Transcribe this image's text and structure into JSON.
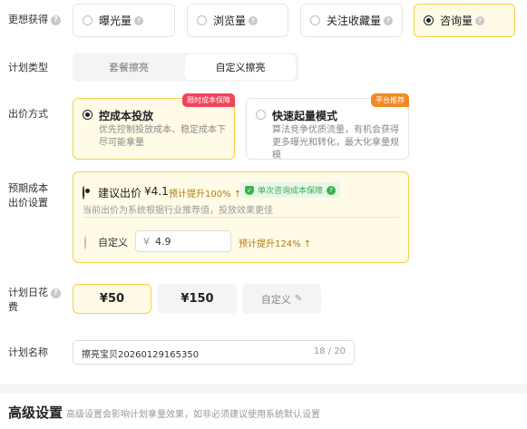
{
  "desired_gain": {
    "label": "更想获得",
    "options": [
      {
        "label": "曝光量",
        "selected": false
      },
      {
        "label": "浏览量",
        "selected": false
      },
      {
        "label": "关注收藏量",
        "selected": false
      },
      {
        "label": "咨询量",
        "selected": true
      }
    ]
  },
  "plan_type": {
    "label": "计划类型",
    "tabs": [
      {
        "label": "套餐擦亮",
        "active": false
      },
      {
        "label": "自定义擦亮",
        "active": true
      }
    ]
  },
  "bid_method": {
    "label": "出价方式",
    "options": [
      {
        "title": "控成本投放",
        "desc": "优先控制投放成本、稳定成本下尽可能拿量",
        "tag": "限时成本保障",
        "selected": true
      },
      {
        "title": "快速起量模式",
        "desc": "算法竞争优质流量，有机会获得更多曝光和转化，最大化拿量规模",
        "tag": "平台推荐",
        "selected": false
      }
    ]
  },
  "expected_cost": {
    "label_line1": "预期成本",
    "label_line2": "出价设置",
    "suggested_label": "建议出价",
    "suggested_value": "¥4.1",
    "suggested_boost": "预计提升100%",
    "guarantee_badge": "单次咨询成本保障",
    "suggested_hint": "当前出价为系统根据行业推荐值，投放效果更佳",
    "custom_label": "自定义",
    "custom_currency": "¥",
    "custom_value": "4.9",
    "custom_boost": "预计提升124%"
  },
  "daily_budget": {
    "label_line1": "计划日花",
    "label_line2": "费",
    "options": [
      "¥50",
      "¥150",
      "自定义"
    ]
  },
  "plan_name": {
    "label": "计划名称",
    "value": "擦亮宝贝20260129165350",
    "counter": "18 / 20"
  },
  "advanced": {
    "title": "高级设置",
    "desc": "高级设置会影响计划拿量效果，如非必须建议使用系统默认设置"
  },
  "colors": {
    "accent_yellow": "#f5cf4a",
    "selected_bg": "#fffbe6",
    "tag_red": "#f2445a",
    "tag_orange": "#f08a24",
    "boost_text": "#b07a0e",
    "badge_green": "#3bb24a"
  }
}
